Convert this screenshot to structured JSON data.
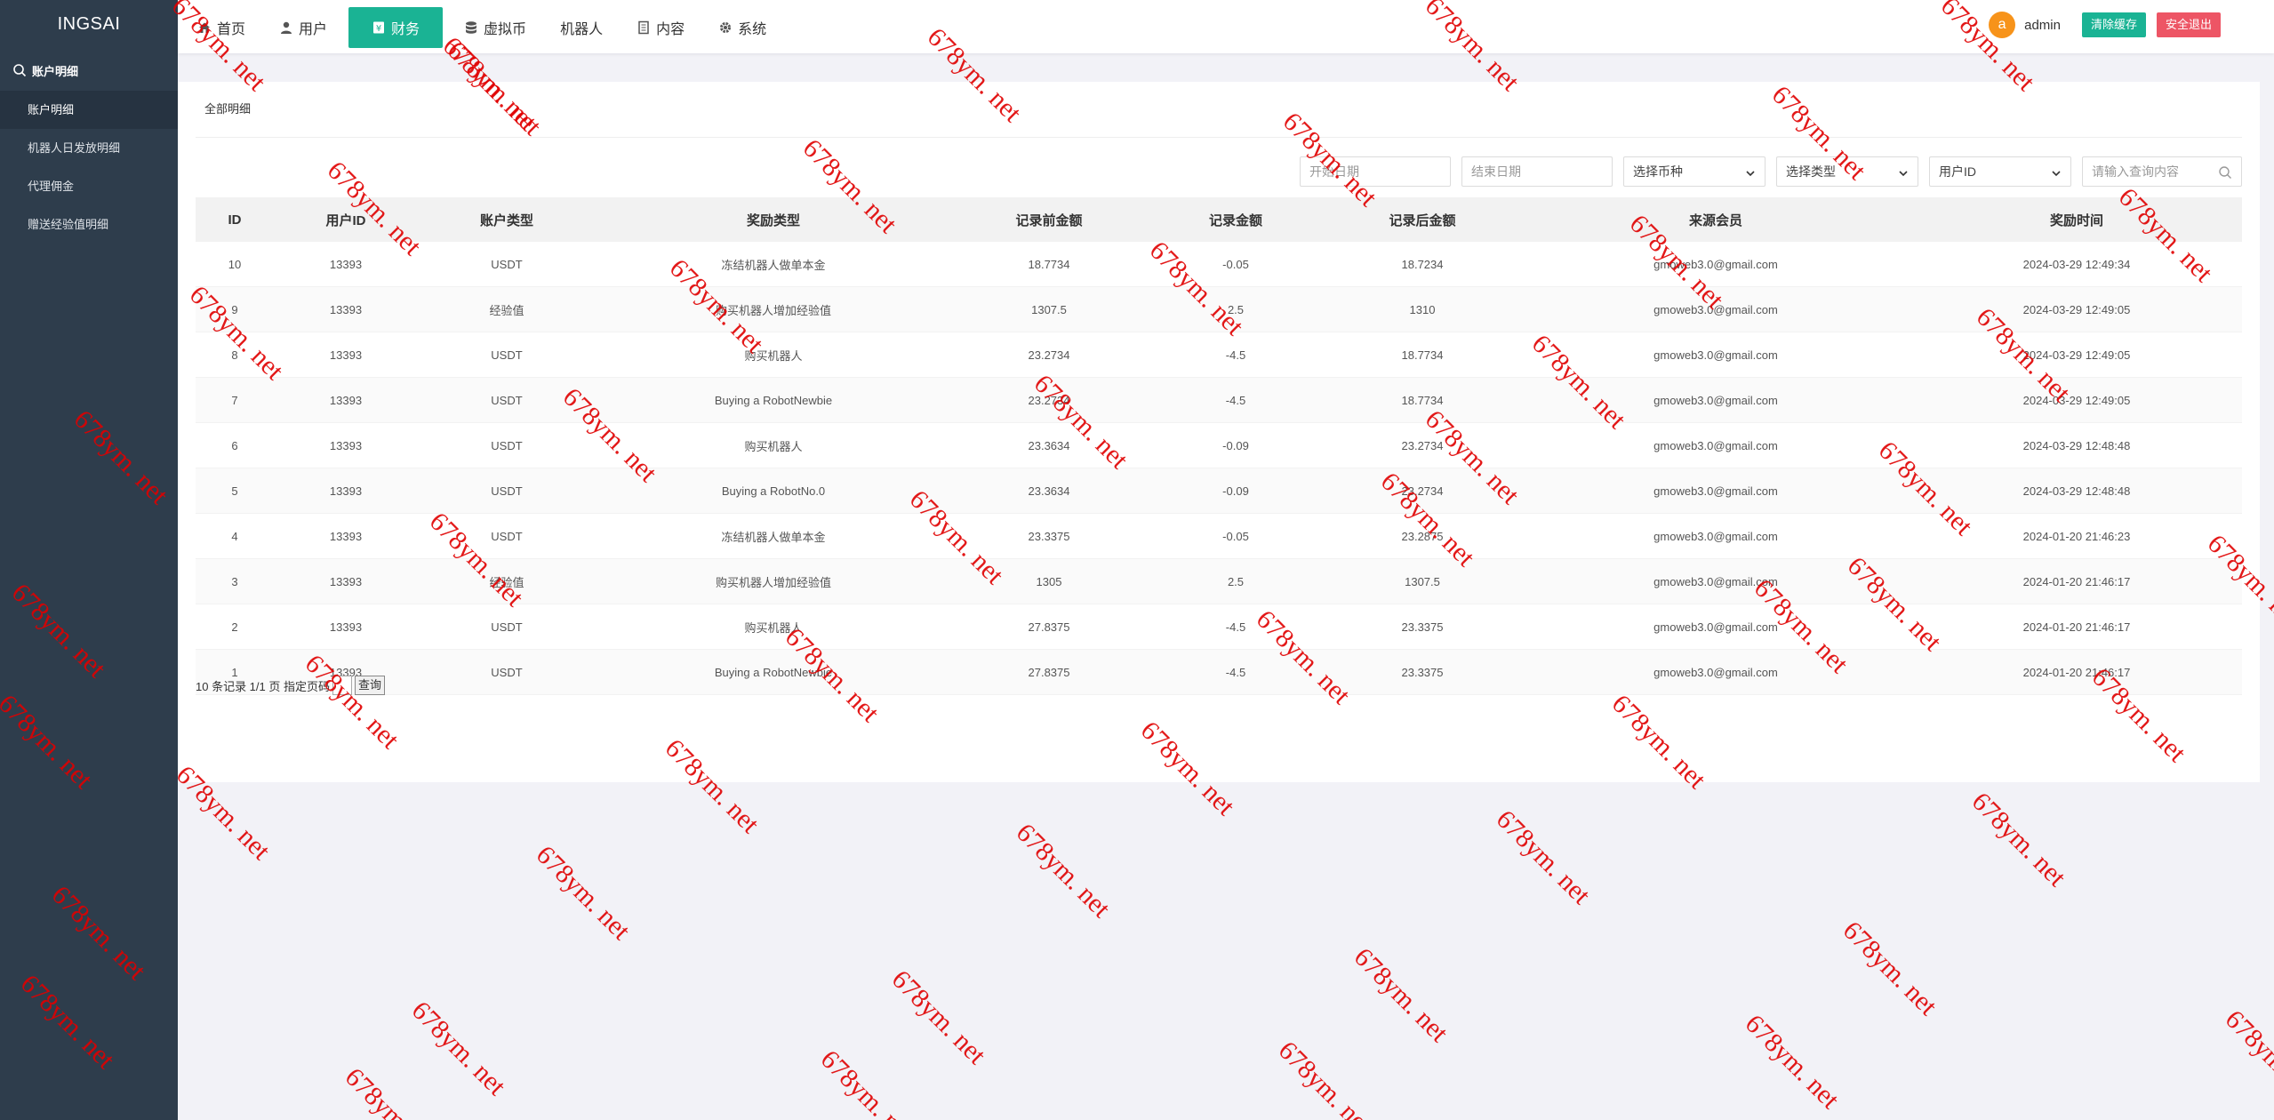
{
  "app": {
    "brand": "INGSAI"
  },
  "sidebar": {
    "group_label": "账户明细",
    "items": [
      {
        "label": "账户明细",
        "active": true
      },
      {
        "label": "机器人日发放明细",
        "active": false
      },
      {
        "label": "代理佣金",
        "active": false
      },
      {
        "label": "赠送经验值明细",
        "active": false
      }
    ]
  },
  "topnav": {
    "items": [
      {
        "label": "首页",
        "icon": "home-icon",
        "active": false
      },
      {
        "label": "用户",
        "icon": "user-icon",
        "active": false
      },
      {
        "label": "财务",
        "icon": "finance-icon",
        "active": true
      },
      {
        "label": "虚拟币",
        "icon": "database-icon",
        "active": false
      },
      {
        "label": "机器人",
        "icon": "",
        "active": false
      },
      {
        "label": "内容",
        "icon": "document-icon",
        "active": false
      },
      {
        "label": "系统",
        "icon": "gear-icon",
        "active": false
      }
    ],
    "avatar_letter": "a",
    "admin_name": "admin",
    "clear_cache_label": "清除缓存",
    "logout_label": "安全退出"
  },
  "panel": {
    "title": "全部明细"
  },
  "filters": {
    "start_date_placeholder": "开始日期",
    "end_date_placeholder": "结束日期",
    "currency_select": "选择币种",
    "type_select": "选择类型",
    "user_select": "用户ID",
    "search_placeholder": "请输入查询内容"
  },
  "table": {
    "columns": [
      "ID",
      "用户ID",
      "账户类型",
      "奖励类型",
      "记录前金额",
      "记录金额",
      "记录后金额",
      "来源会员",
      "奖励时间"
    ],
    "rows": [
      [
        "10",
        "13393",
        "USDT",
        "冻结机器人做单本金",
        "18.7734",
        "-0.05",
        "18.7234",
        "gmoweb3.0@gmail.com",
        "2024-03-29 12:49:34"
      ],
      [
        "9",
        "13393",
        "经验值",
        "购买机器人增加经验值",
        "1307.5",
        "2.5",
        "1310",
        "gmoweb3.0@gmail.com",
        "2024-03-29 12:49:05"
      ],
      [
        "8",
        "13393",
        "USDT",
        "购买机器人",
        "23.2734",
        "-4.5",
        "18.7734",
        "gmoweb3.0@gmail.com",
        "2024-03-29 12:49:05"
      ],
      [
        "7",
        "13393",
        "USDT",
        "Buying a RobotNewbie",
        "23.2734",
        "-4.5",
        "18.7734",
        "gmoweb3.0@gmail.com",
        "2024-03-29 12:49:05"
      ],
      [
        "6",
        "13393",
        "USDT",
        "购买机器人",
        "23.3634",
        "-0.09",
        "23.2734",
        "gmoweb3.0@gmail.com",
        "2024-03-29 12:48:48"
      ],
      [
        "5",
        "13393",
        "USDT",
        "Buying a RobotNo.0",
        "23.3634",
        "-0.09",
        "23.2734",
        "gmoweb3.0@gmail.com",
        "2024-03-29 12:48:48"
      ],
      [
        "4",
        "13393",
        "USDT",
        "冻结机器人做单本金",
        "23.3375",
        "-0.05",
        "23.2875",
        "gmoweb3.0@gmail.com",
        "2024-01-20 21:46:23"
      ],
      [
        "3",
        "13393",
        "经验值",
        "购买机器人增加经验值",
        "1305",
        "2.5",
        "1307.5",
        "gmoweb3.0@gmail.com",
        "2024-01-20 21:46:17"
      ],
      [
        "2",
        "13393",
        "USDT",
        "购买机器人",
        "27.8375",
        "-4.5",
        "23.3375",
        "gmoweb3.0@gmail.com",
        "2024-01-20 21:46:17"
      ],
      [
        "1",
        "13393",
        "USDT",
        "Buying a RobotNewbie",
        "27.8375",
        "-4.5",
        "23.3375",
        "gmoweb3.0@gmail.com",
        "2024-01-20 21:46:17"
      ]
    ]
  },
  "pager": {
    "summary": "10 条记录 1/1 页 指定页码",
    "query_label": "查询"
  },
  "watermark": {
    "text": "678ym. net",
    "color": "#e00000"
  }
}
